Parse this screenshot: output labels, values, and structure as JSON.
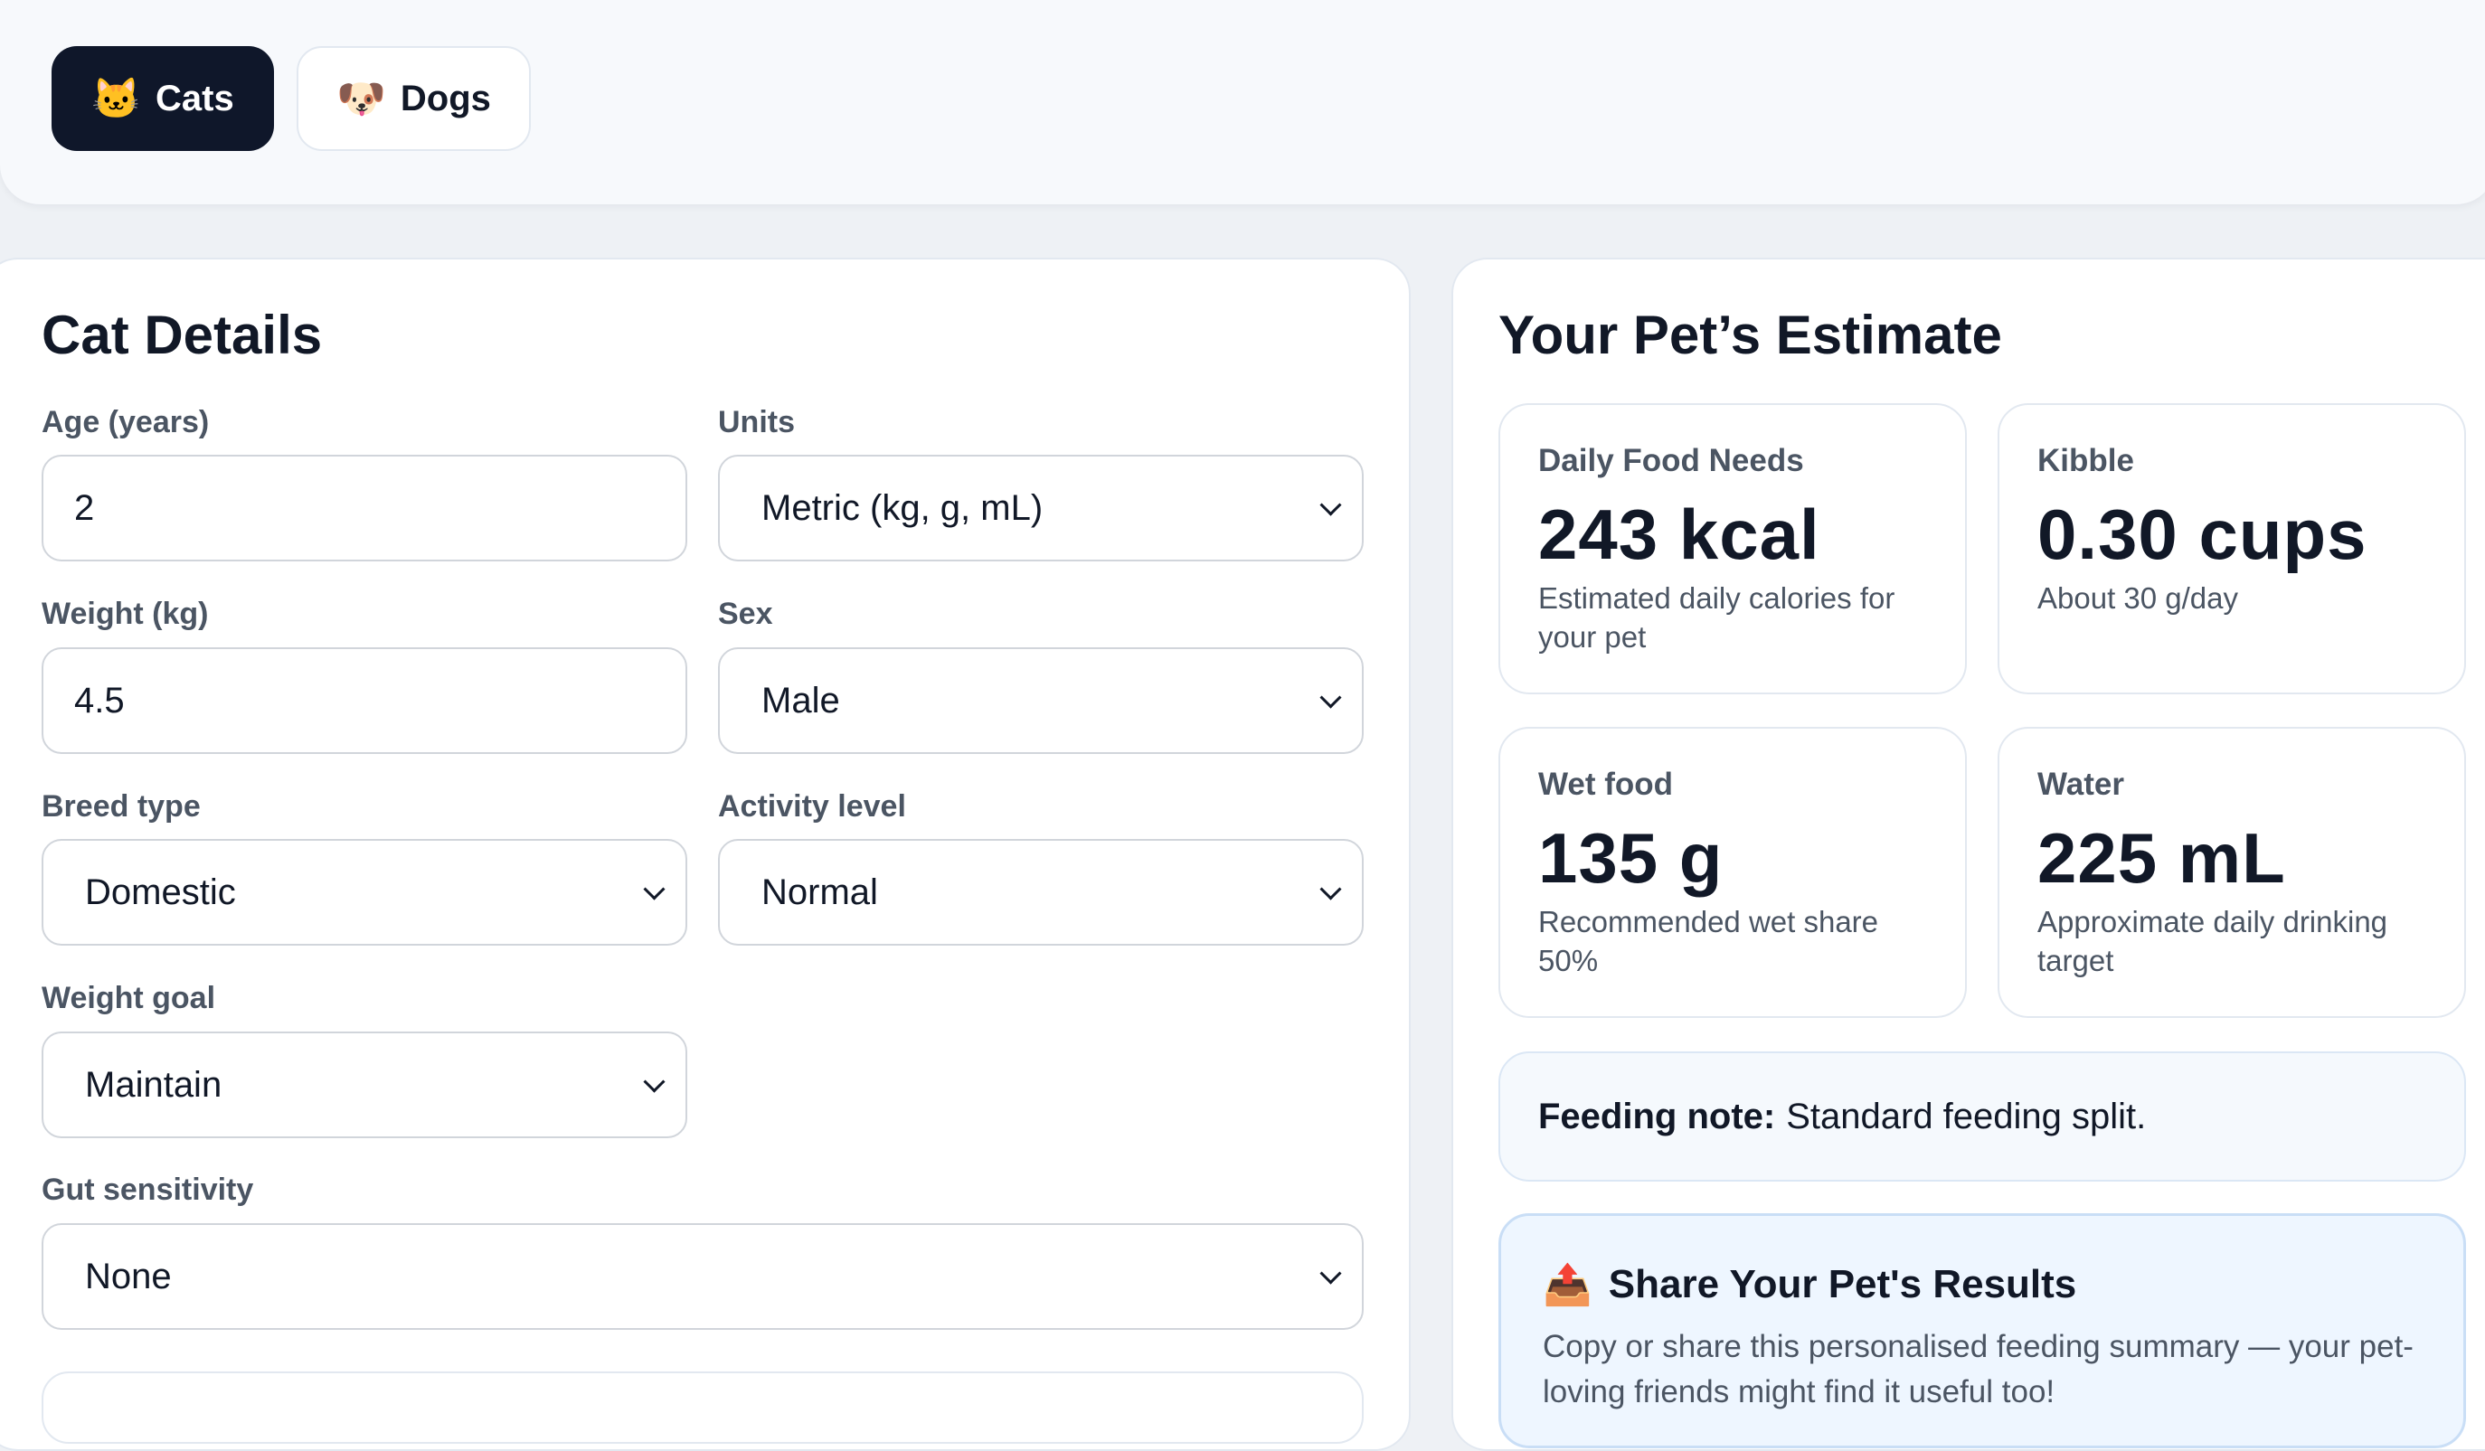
{
  "tabs": [
    {
      "label": "Cats",
      "icon": "cat-face-icon",
      "glyph": "🐱",
      "active": true
    },
    {
      "label": "Dogs",
      "icon": "dog-face-icon",
      "glyph": "🐶",
      "active": false
    }
  ],
  "form": {
    "title": "Cat Details",
    "age": {
      "label": "Age (years)",
      "value": "2"
    },
    "units": {
      "label": "Units",
      "value": "Metric (kg, g, mL)"
    },
    "weight": {
      "label": "Weight (kg)",
      "value": "4.5"
    },
    "sex": {
      "label": "Sex",
      "value": "Male"
    },
    "breed": {
      "label": "Breed type",
      "value": "Domestic"
    },
    "activity": {
      "label": "Activity level",
      "value": "Normal"
    },
    "goal": {
      "label": "Weight goal",
      "value": "Maintain"
    },
    "gut": {
      "label": "Gut sensitivity",
      "value": "None"
    }
  },
  "estimate": {
    "title": "Your Pet’s Estimate",
    "cards": [
      {
        "title": "Daily Food Needs",
        "value": "243 kcal",
        "desc": "Estimated daily calories for your pet"
      },
      {
        "title": "Kibble",
        "value": "0.30 cups",
        "desc": "About 30 g/day"
      },
      {
        "title": "Wet food",
        "value": "135 g",
        "desc": "Recommended wet share 50%"
      },
      {
        "title": "Water",
        "value": "225 mL",
        "desc": "Approximate daily drinking target"
      }
    ],
    "note": {
      "label": "Feeding note:",
      "text": "Standard feeding split."
    },
    "share": {
      "icon": "outbox-tray-icon",
      "glyph": "📤",
      "title": "Share Your Pet's Results",
      "desc": "Copy or share this personalised feeding summary — your pet-loving friends might find it useful too!"
    }
  },
  "colors": {
    "accent": "#0f172a",
    "panel_border": "#e2e8f0",
    "share_bg": "#eef6ff"
  }
}
